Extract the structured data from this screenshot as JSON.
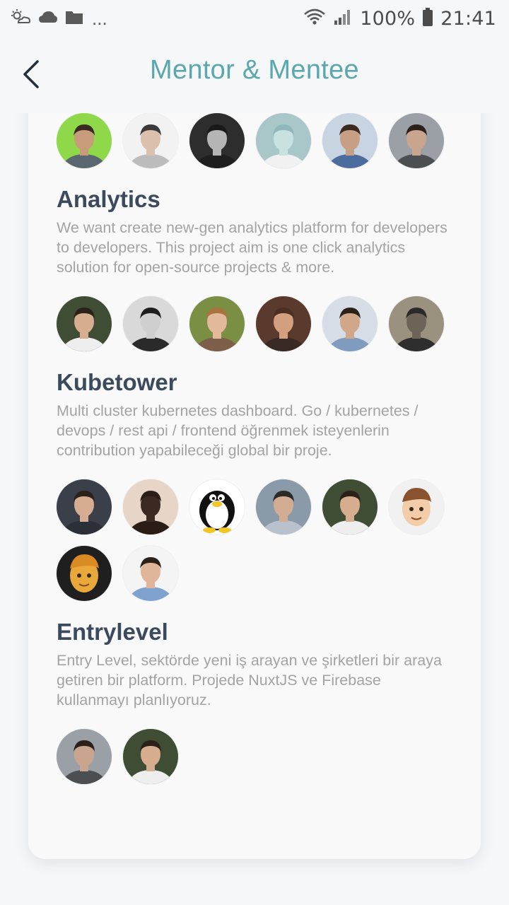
{
  "status_bar": {
    "battery": "100%",
    "time": "21:41",
    "overflow": "..."
  },
  "header": {
    "title": "Mentor & Mentee"
  },
  "top_avatars": [
    {
      "bg": "#8fd84a",
      "face": "#c89b7b",
      "hair": "#3a2b22",
      "shirt": "#5b6770"
    },
    {
      "bg": "#f2f2f2",
      "face": "#dcc0ae",
      "hair": "#3a3a3a",
      "shirt": "#bcbcbc"
    },
    {
      "bg": "#2d2d2d",
      "face": "#b5b5b5",
      "hair": "#1a1a1a",
      "shirt": "#1f1f1f"
    },
    {
      "bg": "#a9c6c9",
      "face": "#c8e2e2",
      "hair": "#8fb7bc",
      "shirt": "#f1f1f1"
    },
    {
      "bg": "#c9d4e2",
      "face": "#c79f84",
      "hair": "#3b2a20",
      "shirt": "#4b6c9c"
    },
    {
      "bg": "#9aa0a5",
      "face": "#c9a48e",
      "hair": "#2b2119",
      "shirt": "#4b4f52"
    }
  ],
  "projects": [
    {
      "title": "Analytics",
      "description": "We want create new-gen analytics platform for developers to developers. This project aim is one click analytics solution for open-source projects & more.",
      "avatars": [
        {
          "bg": "#3e4d34",
          "face": "#d7ad8f",
          "hair": "#2b2119",
          "shirt": "#eeeeee"
        },
        {
          "bg": "#d9d9d9",
          "face": "#cfcfcf",
          "hair": "#1e1e1e",
          "shirt": "#2a2a2a"
        },
        {
          "bg": "#7a8f44",
          "face": "#e2b99a",
          "hair": "#a9743f",
          "shirt": "#7d5e48"
        },
        {
          "bg": "#5a3a2c",
          "face": "#d2a07f",
          "hair": "#4a2f22",
          "shirt": "#3a2a26"
        },
        {
          "bg": "#d6dde6",
          "face": "#d0a889",
          "hair": "#2b2119",
          "shirt": "#7f9bbd"
        },
        {
          "bg": "#9a917f",
          "face": "#6e6357",
          "hair": "#2a2a2a",
          "shirt": "#2e2e2e"
        }
      ]
    },
    {
      "title": "Kubetower",
      "description": "Multi cluster kubernetes dashboard. Go / kubernetes / devops / rest api / frontend öğrenmek isteyenlerin contribution yapabileceği global bir proje.",
      "avatars": [
        {
          "bg": "#3a3f4a",
          "face": "#d6ad92",
          "hair": "#2b2119",
          "shirt": "#2b2f38"
        },
        {
          "bg": "#e7d6c8",
          "face": "#3a2a22",
          "hair": "#2a1d16",
          "shirt": "#2a1d16"
        },
        {
          "bg": "#ffffff",
          "face": "#ffffff",
          "hair": "#111111",
          "shirt": "#f3c623",
          "type": "penguin"
        },
        {
          "bg": "#8a9aa8",
          "face": "#d2ad93",
          "hair": "#2a2a2a",
          "shirt": "#b9c2cc"
        },
        {
          "bg": "#3e4d34",
          "face": "#d7ad8f",
          "hair": "#2b2119",
          "shirt": "#eeeeee"
        },
        {
          "bg": "#f1f1f1",
          "face": "#f3cda9",
          "hair": "#8a5330",
          "shirt": "#f1f1f1",
          "type": "memoji"
        },
        {
          "bg": "#1f1f1f",
          "face": "#e8a83a",
          "hair": "#d88a23",
          "shirt": "#1f1f1f",
          "type": "memoji"
        },
        {
          "bg": "#f4f4f4",
          "face": "#e0b59a",
          "hair": "#2b2119",
          "shirt": "#7fa2cf"
        }
      ]
    },
    {
      "title": "Entrylevel",
      "description": "Entry Level, sektörde yeni iş arayan ve şirketleri bir araya getiren bir platform. Projede NuxtJS ve Firebase kullanmayı planlıyoruz.",
      "avatars": [
        {
          "bg": "#9aa0a5",
          "face": "#c9a48e",
          "hair": "#2b2119",
          "shirt": "#4b4f52"
        },
        {
          "bg": "#3e4d34",
          "face": "#d7ad8f",
          "hair": "#2b2119",
          "shirt": "#eeeeee"
        }
      ]
    }
  ]
}
